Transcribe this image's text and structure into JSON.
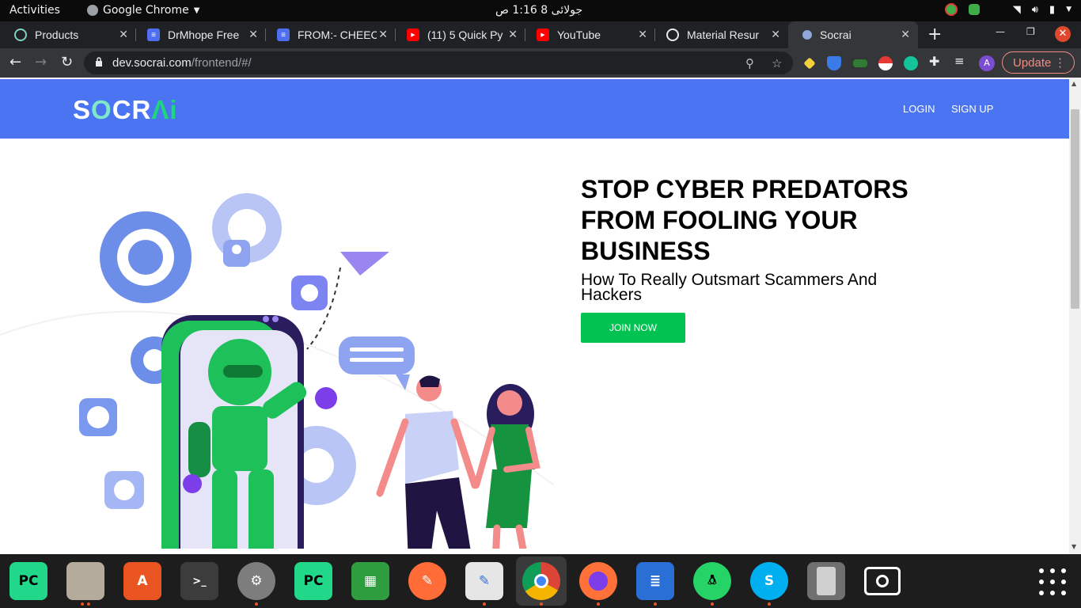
{
  "topbar": {
    "activities": "Activities",
    "app_name": "Google Chrome",
    "clock": "جولائی 8  1:16 ص"
  },
  "tabs": [
    {
      "title": "Products",
      "icon": "products-icon"
    },
    {
      "title": "DrMhope Free",
      "icon": "docs-icon"
    },
    {
      "title": "FROM:- CHEEC",
      "icon": "docs-icon"
    },
    {
      "title": "(11) 5 Quick Py",
      "icon": "youtube-icon"
    },
    {
      "title": "YouTube",
      "icon": "youtube-icon"
    },
    {
      "title": "Material Resur",
      "icon": "globe-icon"
    },
    {
      "title": "Socrai",
      "icon": "socrai-icon",
      "active": true
    }
  ],
  "toolbar": {
    "url_host": "dev.socrai.com",
    "url_path": "/frontend/#/",
    "update_label": "Update"
  },
  "site": {
    "logo_a": "S",
    "logo_o": "O",
    "logo_b": "CR",
    "logo_ai": "Λi",
    "login": "LOGIN",
    "signup": "SIGN UP",
    "headline": "STOP CYBER PREDATORS FROM FOOLING YOUR BUSINESS",
    "subhead": "How To Really Outsmart Scammers And Hackers",
    "cta": "JOIN NOW"
  },
  "colors": {
    "nav_bg": "#4a74f2",
    "cta_bg": "#02c251",
    "robot_green": "#1ec05a",
    "phone_dark": "#2a1d5e"
  },
  "dock": [
    "pycharm-icon",
    "files-icon",
    "app-center-icon",
    "terminal-icon",
    "settings-icon",
    "pycharm-ce-icon",
    "spreadsheet-icon",
    "postman-icon",
    "text-editor-icon",
    "chrome-icon",
    "firefox-icon",
    "writer-icon",
    "whatsapp-icon",
    "skype-icon",
    "tablet-icon",
    "screenshot-icon"
  ]
}
